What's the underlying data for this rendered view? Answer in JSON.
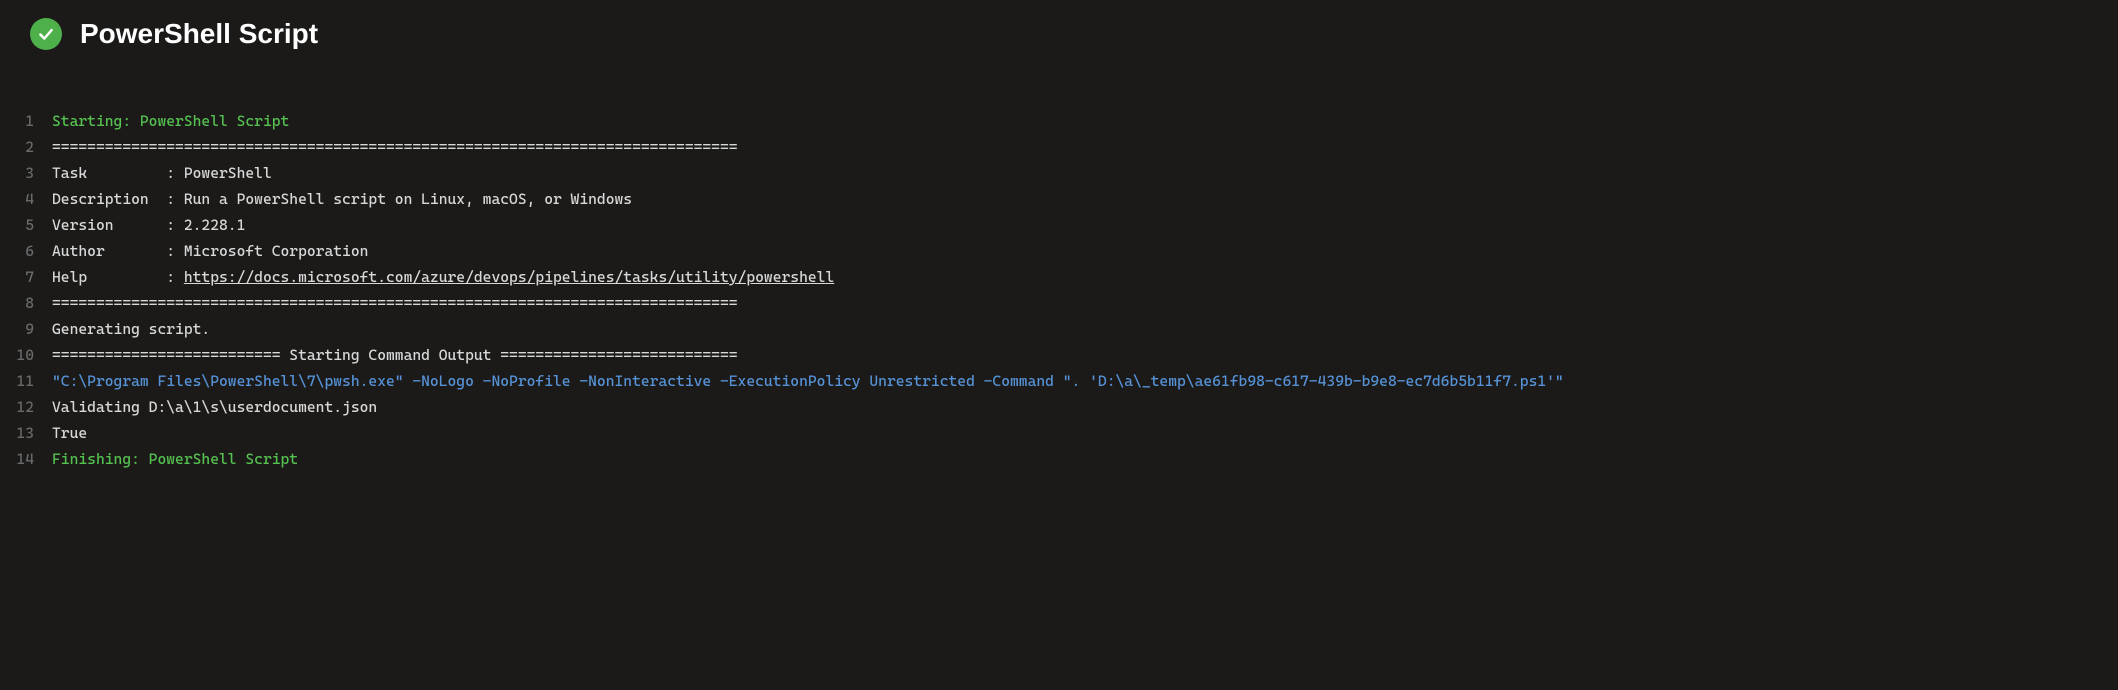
{
  "header": {
    "title": "PowerShell Script",
    "status": "success"
  },
  "log": {
    "lines": [
      {
        "n": 1,
        "color": "green",
        "text": "Starting: PowerShell Script"
      },
      {
        "n": 2,
        "color": "",
        "text": "=============================================================================="
      },
      {
        "n": 3,
        "color": "",
        "text": "Task         : PowerShell"
      },
      {
        "n": 4,
        "color": "",
        "text": "Description  : Run a PowerShell script on Linux, macOS, or Windows"
      },
      {
        "n": 5,
        "color": "",
        "text": "Version      : 2.228.1"
      },
      {
        "n": 6,
        "color": "",
        "text": "Author       : Microsoft Corporation"
      },
      {
        "n": 7,
        "color": "",
        "prefix": "Help         : ",
        "link": "https://docs.microsoft.com/azure/devops/pipelines/tasks/utility/powershell"
      },
      {
        "n": 8,
        "color": "",
        "text": "=============================================================================="
      },
      {
        "n": 9,
        "color": "",
        "text": "Generating script."
      },
      {
        "n": 10,
        "color": "",
        "text": "========================== Starting Command Output ==========================="
      },
      {
        "n": 11,
        "color": "blue",
        "text": "\"C:\\Program Files\\PowerShell\\7\\pwsh.exe\" -NoLogo -NoProfile -NonInteractive -ExecutionPolicy Unrestricted -Command \". 'D:\\a\\_temp\\ae61fb98-c617-439b-b9e8-ec7d6b5b11f7.ps1'\""
      },
      {
        "n": 12,
        "color": "",
        "text": "Validating D:\\a\\1\\s\\userdocument.json"
      },
      {
        "n": 13,
        "color": "",
        "text": "True"
      },
      {
        "n": 14,
        "color": "green",
        "text": "Finishing: PowerShell Script"
      }
    ]
  }
}
